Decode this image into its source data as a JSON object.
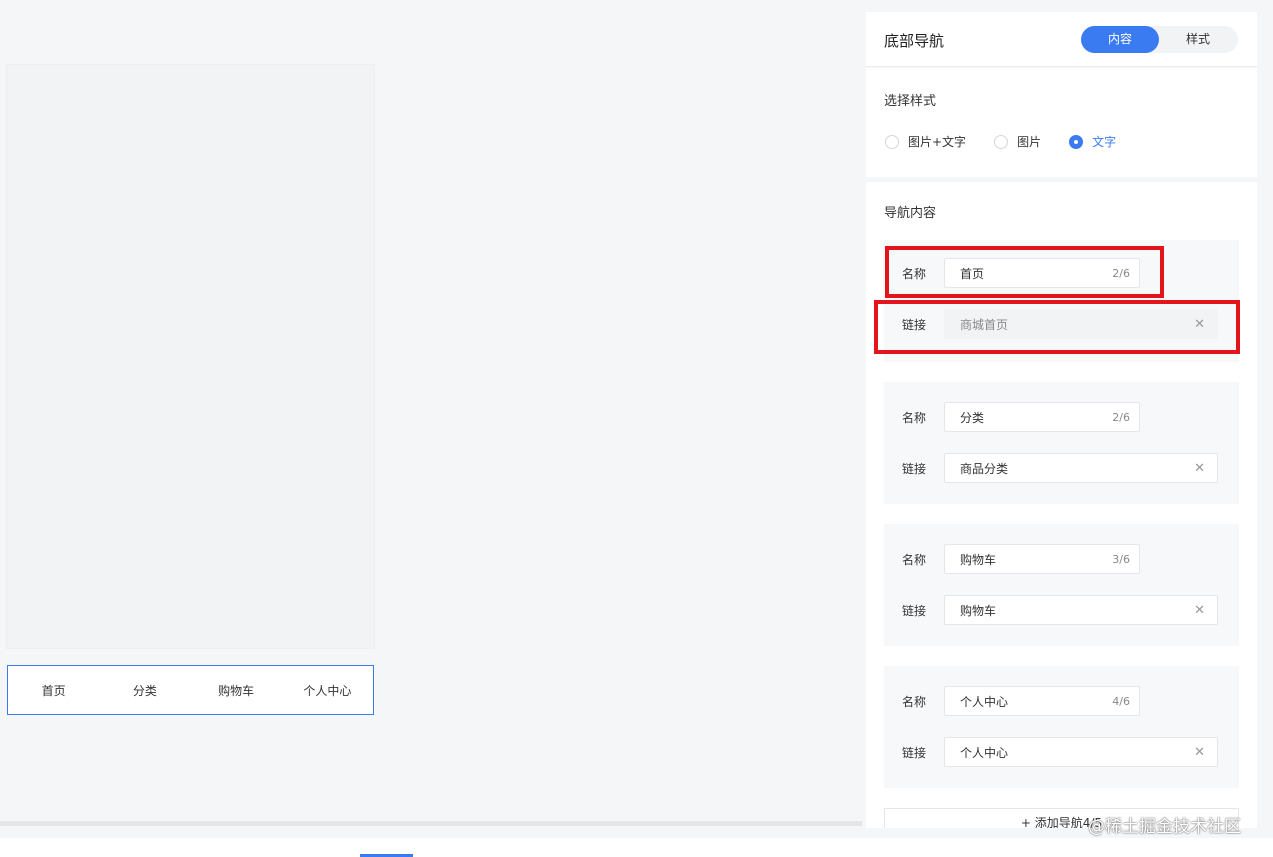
{
  "preview": {
    "nav_items": [
      "首页",
      "分类",
      "购物车",
      "个人中心"
    ]
  },
  "panel": {
    "title": "底部导航",
    "tabs": [
      {
        "label": "内容",
        "active": true
      },
      {
        "label": "样式",
        "active": false
      }
    ],
    "style_section": {
      "title": "选择样式",
      "options": [
        {
          "label": "图片+文字",
          "checked": false
        },
        {
          "label": "图片",
          "checked": false
        },
        {
          "label": "文字",
          "checked": true
        }
      ]
    },
    "content_section": {
      "title": "导航内容",
      "name_label": "名称",
      "link_label": "链接",
      "items": [
        {
          "name": "首页",
          "count": "2/6",
          "link": "商城首页"
        },
        {
          "name": "分类",
          "count": "2/6",
          "link": "商品分类"
        },
        {
          "name": "购物车",
          "count": "3/6",
          "link": "购物车"
        },
        {
          "name": "个人中心",
          "count": "4/6",
          "link": "个人中心"
        }
      ],
      "add_button": "+ 添加导航4/5"
    }
  },
  "watermark": "@稀土掘金技术社区",
  "colors": {
    "accent": "#3a7bf2",
    "highlight": "#e3141b"
  }
}
